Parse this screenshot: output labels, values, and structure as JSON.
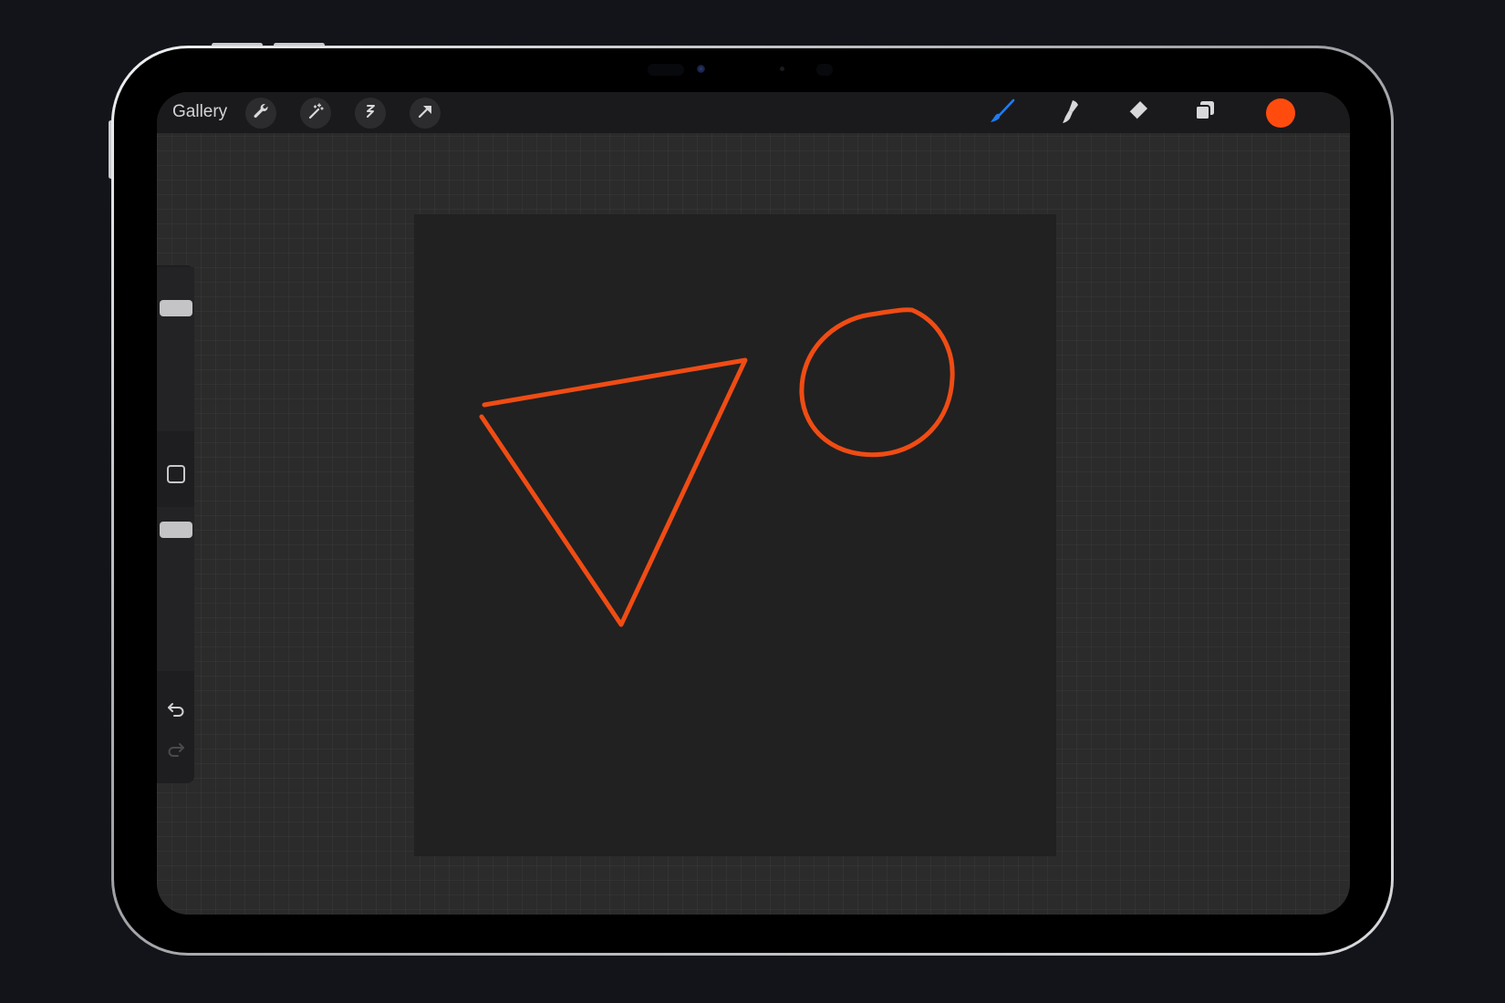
{
  "toolbar": {
    "gallery_label": "Gallery",
    "left_tools": [
      {
        "icon": "wrench-icon",
        "name": "actions"
      },
      {
        "icon": "magic-wand-icon",
        "name": "adjustments"
      },
      {
        "icon": "selection-icon",
        "name": "selection"
      },
      {
        "icon": "arrow-cursor-icon",
        "name": "transform"
      }
    ],
    "right_tools": [
      {
        "icon": "brush-icon",
        "name": "paint",
        "active": true
      },
      {
        "icon": "smudge-icon",
        "name": "smudge",
        "active": false
      },
      {
        "icon": "eraser-icon",
        "name": "erase",
        "active": false
      },
      {
        "icon": "layers-icon",
        "name": "layers",
        "active": false
      }
    ],
    "current_color": "#ff4c0e"
  },
  "colors": {
    "active_tool": "#1f7cf3",
    "inactive_tool": "#d8d8da",
    "stroke": "#f04c14",
    "canvas": "#212121",
    "workspace": "#2b2b2b"
  },
  "sidebar": {
    "brush_size": 0.85,
    "brush_opacity": 0.93,
    "redo_enabled": false
  },
  "artwork": {
    "shapes": [
      "triangle",
      "circle"
    ],
    "stroke_color": "#f04c14"
  }
}
